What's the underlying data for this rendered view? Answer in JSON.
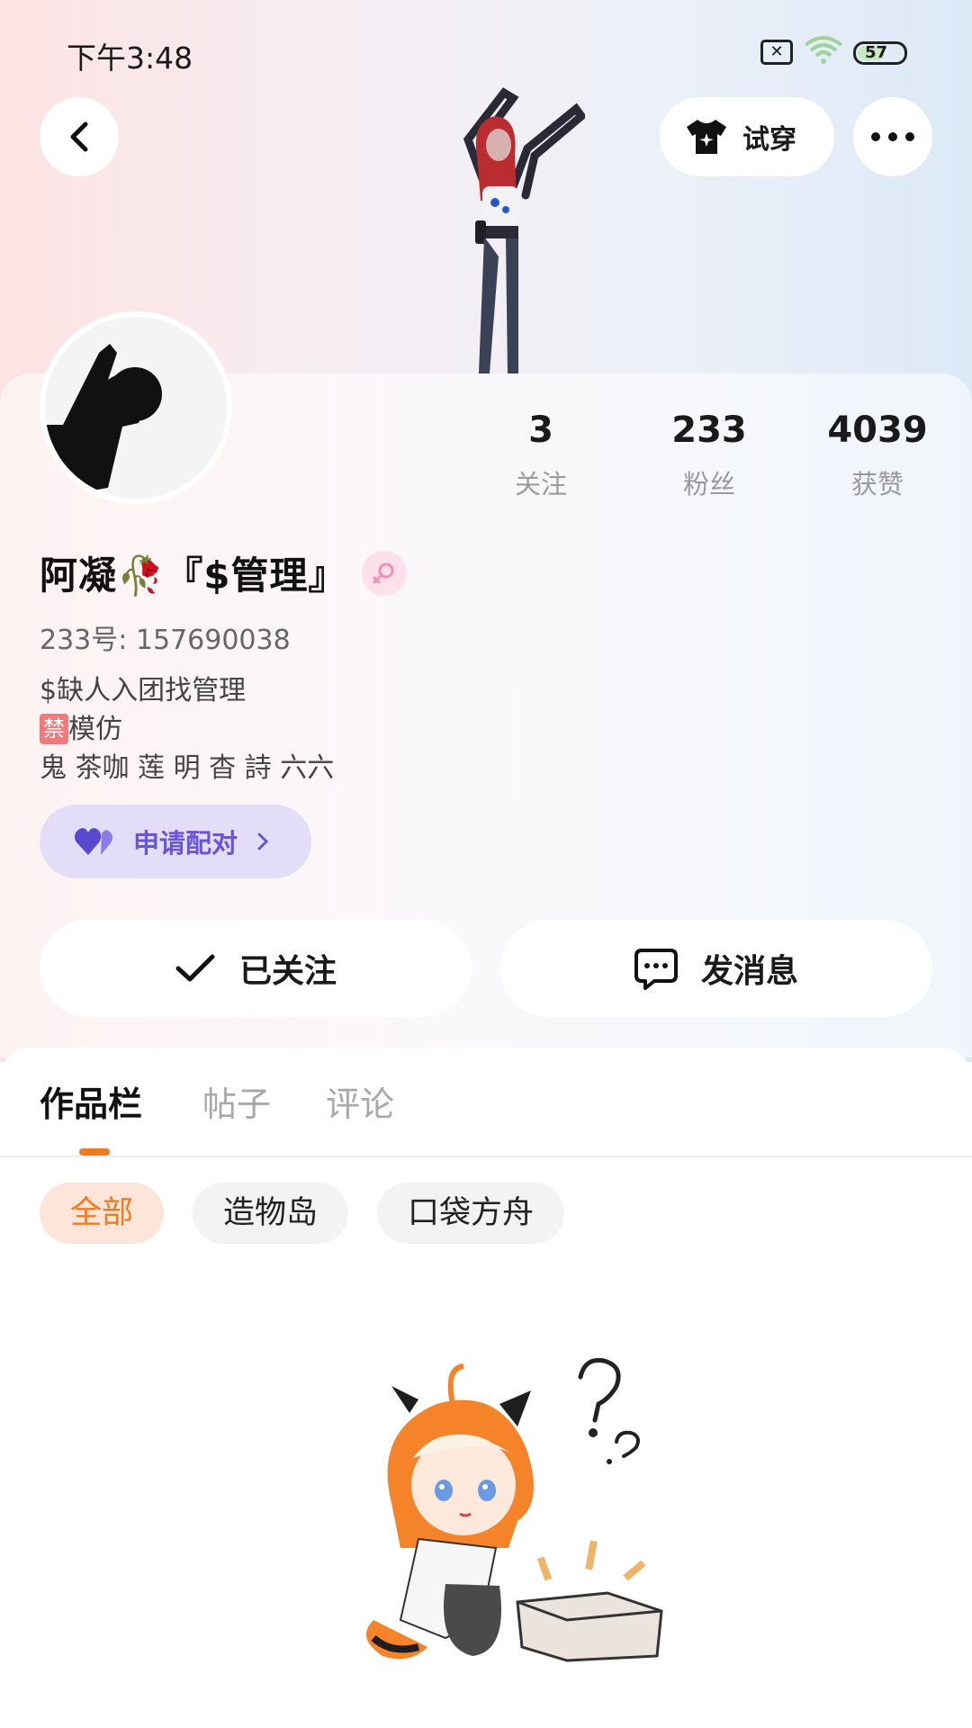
{
  "status_bar": {
    "time": "下午3:48",
    "battery": "57"
  },
  "header": {
    "try_on_label": "试穿"
  },
  "profile": {
    "stats": [
      {
        "value": "3",
        "label": "关注"
      },
      {
        "value": "233",
        "label": "粉丝"
      },
      {
        "value": "4039",
        "label": "获赞"
      }
    ],
    "name": "阿凝🥀『$管理』",
    "uid": "233号: 157690038",
    "bio_line1": "$缺人入团找管理",
    "bio_ban_badge": "禁",
    "bio_line2": "模仿",
    "bio_line3": "鬼 茶咖 莲 明 杳 詩 六六",
    "pair_label": "申请配对"
  },
  "actions": {
    "follow_label": "已关注",
    "message_label": "发消息"
  },
  "tabs": [
    {
      "label": "作品栏",
      "active": true
    },
    {
      "label": "帖子",
      "active": false
    },
    {
      "label": "评论",
      "active": false
    }
  ],
  "chips": [
    {
      "label": "全部",
      "active": true
    },
    {
      "label": "造物岛",
      "active": false
    },
    {
      "label": "口袋方舟",
      "active": false
    }
  ],
  "colors": {
    "accent": "#f07a22",
    "pair_purple": "#6b55d6",
    "gender_pink": "#f5a0bd"
  },
  "icons": [
    "back-icon",
    "tshirt-icon",
    "more-icon",
    "female-icon",
    "heart-pair-icon",
    "chevron-right-icon",
    "check-icon",
    "chat-icon"
  ]
}
